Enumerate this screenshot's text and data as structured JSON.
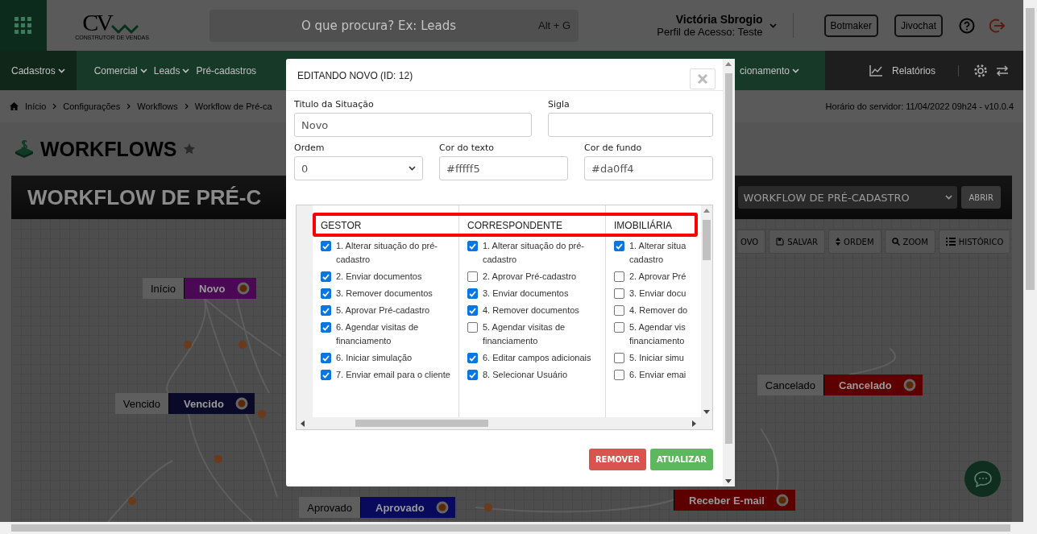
{
  "header": {
    "logo": "CV",
    "tagline": "CONSTRUTOR DE VENDAS",
    "search_placeholder": "O que procura? Ex: Leads",
    "shortcut": "Alt + G",
    "user_name": "Victória Sbrogio",
    "user_profile": "Perfil de Acesso: Teste",
    "buttons": [
      "Botmaker",
      "Jivochat"
    ]
  },
  "nav": {
    "items": [
      {
        "label": "Cadastros",
        "selected": true
      },
      {
        "label": "Comercial",
        "selected": false
      },
      {
        "label": "Leads",
        "selected": false
      },
      {
        "label": "Pré-cadastros",
        "selected": false
      }
    ],
    "right_item": "cionamento",
    "reports": "Relatórios"
  },
  "breadcrumb": {
    "items": [
      "Início",
      "Configurações",
      "Workflows",
      "Workflow de Pré-ca"
    ],
    "server_time": "Horário do servidor: 11/04/2022 09h24 - v10.0.4"
  },
  "page_title": "WORKFLOWS",
  "workflow_bar": {
    "title": "WORKFLOW DE PRÉ-C",
    "select_value": "WORKFLOW DE PRÉ-CADASTRO",
    "open_button": "ABRIR"
  },
  "toolbar": [
    {
      "kind": "new",
      "label": "OVO"
    },
    {
      "kind": "save",
      "label": "SALVAR"
    },
    {
      "kind": "order",
      "label": "ORDEM"
    },
    {
      "kind": "zoom",
      "label": "ZOOM"
    },
    {
      "kind": "history",
      "label": "HISTÓRICO"
    }
  ],
  "nodes": [
    {
      "label": "Início",
      "title": "Novo",
      "color": "#4b0854"
    },
    {
      "label": "Vencido",
      "title": "Vencido",
      "color": "#0a0a28"
    },
    {
      "label": "Cancelado",
      "title": "Cancelado",
      "color": "#5c0000"
    },
    {
      "label": "Aprovado",
      "title": "Aprovado",
      "color": "#0a0a5c"
    },
    {
      "title": "Receber E-mail",
      "color": "#5c0000"
    }
  ],
  "modal": {
    "title": "EDITANDO NOVO (ID: 12)",
    "title_field": {
      "label": "Titulo da Situação",
      "value": "Novo"
    },
    "sigla_field": {
      "label": "Sigla"
    },
    "order_field": {
      "label": "Ordem",
      "value": "0"
    },
    "text_color_field": {
      "label": "Cor do texto",
      "value": "#fffff5"
    },
    "bg_color_field": {
      "label": "Cor de fundo",
      "value": "#da0ff4"
    },
    "permissions": [
      {
        "title": "GESTOR",
        "items": [
          {
            "label": "1. Alterar situação do pré-cadastro",
            "checked": true
          },
          {
            "label": "2. Enviar documentos",
            "checked": true
          },
          {
            "label": "3. Remover documentos",
            "checked": true
          },
          {
            "label": "5. Aprovar Pré-cadastro",
            "checked": true
          },
          {
            "label": "6. Agendar visitas de financiamento",
            "checked": true
          },
          {
            "label": "6. Iniciar simulação",
            "checked": true
          },
          {
            "label": "7. Enviar email para o cliente",
            "checked": true
          }
        ]
      },
      {
        "title": "CORRESPONDENTE",
        "items": [
          {
            "label": "1. Alterar situação do pré-cadastro",
            "checked": true
          },
          {
            "label": "2. Aprovar Pré-cadastro",
            "checked": false
          },
          {
            "label": "3. Enviar documentos",
            "checked": true
          },
          {
            "label": "4. Remover documentos",
            "checked": true
          },
          {
            "label": "5. Agendar visitas de financiamento",
            "checked": false
          },
          {
            "label": "6. Editar campos adicionais",
            "checked": true
          },
          {
            "label": "8. Selecionar Usuário",
            "checked": true
          }
        ]
      },
      {
        "title": "IMOBILIÁRIA",
        "items": [
          {
            "label": "1. Alterar situa\ncadastro",
            "checked": true
          },
          {
            "label": "2. Aprovar Pré",
            "checked": false
          },
          {
            "label": "3. Enviar docu",
            "checked": false
          },
          {
            "label": "4. Remover do",
            "checked": false
          },
          {
            "label": "5. Agendar vis\nfinanciamento",
            "checked": false
          },
          {
            "label": "5. Iniciar simu",
            "checked": false
          },
          {
            "label": "6. Enviar emai",
            "checked": false
          }
        ]
      }
    ],
    "buttons": {
      "remove": "REMOVER",
      "update": "ATUALIZAR"
    }
  }
}
